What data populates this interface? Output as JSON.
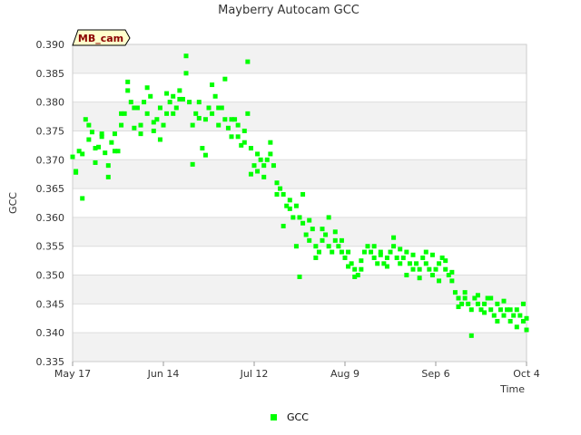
{
  "colors": {
    "series": "#00ff00",
    "band": "#f2f2f2",
    "grid": "#dddddd",
    "badge_bg": "#ffffcc"
  },
  "badge": {
    "label": "MB_cam"
  },
  "chart_data": {
    "type": "scatter",
    "title": "Mayberry Autocam GCC",
    "xlabel": "Time",
    "ylabel": "GCC",
    "x_ticks": [
      "May 17",
      "Jun 14",
      "Jul 12",
      "Aug 9",
      "Sep 6",
      "Oct 4"
    ],
    "x_range": [
      "2020-05-17",
      "2020-10-04"
    ],
    "ylim": [
      0.335,
      0.39
    ],
    "y_ticks": [
      "0.335",
      "0.340",
      "0.345",
      "0.350",
      "0.355",
      "0.360",
      "0.365",
      "0.370",
      "0.375",
      "0.380",
      "0.385",
      "0.390"
    ],
    "grid": "horizontal alternating bands",
    "legend": {
      "position": "bottom-center",
      "entries": [
        "GCC"
      ]
    },
    "series": [
      {
        "name": "GCC",
        "color": "#00ff00",
        "points": [
          [
            "2020-05-17",
            0.3705
          ],
          [
            "2020-05-18",
            0.3678
          ],
          [
            "2020-05-19",
            0.3715
          ],
          [
            "2020-05-20",
            0.3633
          ],
          [
            "2020-05-21",
            0.377
          ],
          [
            "2020-05-22",
            0.3735
          ],
          [
            "2020-05-23",
            0.3748
          ],
          [
            "2020-05-24",
            0.3695
          ],
          [
            "2020-05-25",
            0.3722
          ],
          [
            "2020-05-26",
            0.3745
          ],
          [
            "2020-05-27",
            0.3712
          ],
          [
            "2020-05-28",
            0.369
          ],
          [
            "2020-05-29",
            0.373
          ],
          [
            "2020-05-30",
            0.3745
          ],
          [
            "2020-05-31",
            0.3715
          ],
          [
            "2020-06-01",
            0.376
          ],
          [
            "2020-06-02",
            0.378
          ],
          [
            "2020-06-03",
            0.382
          ],
          [
            "2020-06-04",
            0.38
          ],
          [
            "2020-06-05",
            0.3755
          ],
          [
            "2020-06-06",
            0.379
          ],
          [
            "2020-06-07",
            0.376
          ],
          [
            "2020-06-08",
            0.38
          ],
          [
            "2020-06-09",
            0.378
          ],
          [
            "2020-06-10",
            0.381
          ],
          [
            "2020-06-11",
            0.375
          ],
          [
            "2020-06-12",
            0.377
          ],
          [
            "2020-06-13",
            0.379
          ],
          [
            "2020-06-14",
            0.376
          ],
          [
            "2020-06-15",
            0.378
          ],
          [
            "2020-06-16",
            0.38
          ],
          [
            "2020-06-17",
            0.381
          ],
          [
            "2020-06-18",
            0.379
          ],
          [
            "2020-06-19",
            0.382
          ],
          [
            "2020-06-20",
            0.3805
          ],
          [
            "2020-06-21",
            0.385
          ],
          [
            "2020-06-22",
            0.38
          ],
          [
            "2020-06-23",
            0.376
          ],
          [
            "2020-06-24",
            0.378
          ],
          [
            "2020-06-25",
            0.38
          ],
          [
            "2020-06-26",
            0.372
          ],
          [
            "2020-06-27",
            0.377
          ],
          [
            "2020-06-28",
            0.379
          ],
          [
            "2020-06-29",
            0.378
          ],
          [
            "2020-06-30",
            0.381
          ],
          [
            "2020-07-01",
            0.376
          ],
          [
            "2020-07-02",
            0.379
          ],
          [
            "2020-07-03",
            0.377
          ],
          [
            "2020-07-04",
            0.3755
          ],
          [
            "2020-07-05",
            0.374
          ],
          [
            "2020-07-06",
            0.377
          ],
          [
            "2020-07-07",
            0.374
          ],
          [
            "2020-07-08",
            0.3725
          ],
          [
            "2020-07-09",
            0.375
          ],
          [
            "2020-07-10",
            0.378
          ],
          [
            "2020-07-11",
            0.372
          ],
          [
            "2020-07-12",
            0.369
          ],
          [
            "2020-07-13",
            0.368
          ],
          [
            "2020-07-14",
            0.37
          ],
          [
            "2020-07-15",
            0.369
          ],
          [
            "2020-07-16",
            0.37
          ],
          [
            "2020-07-17",
            0.373
          ],
          [
            "2020-07-18",
            0.369
          ],
          [
            "2020-07-19",
            0.366
          ],
          [
            "2020-07-20",
            0.365
          ],
          [
            "2020-07-21",
            0.364
          ],
          [
            "2020-07-22",
            0.362
          ],
          [
            "2020-07-23",
            0.363
          ],
          [
            "2020-07-24",
            0.36
          ],
          [
            "2020-07-25",
            0.362
          ],
          [
            "2020-07-26",
            0.36
          ],
          [
            "2020-07-27",
            0.359
          ],
          [
            "2020-07-28",
            0.357
          ],
          [
            "2020-07-29",
            0.356
          ],
          [
            "2020-07-30",
            0.358
          ],
          [
            "2020-07-31",
            0.355
          ],
          [
            "2020-08-01",
            0.354
          ],
          [
            "2020-08-02",
            0.356
          ],
          [
            "2020-08-03",
            0.357
          ],
          [
            "2020-08-04",
            0.355
          ],
          [
            "2020-08-05",
            0.354
          ],
          [
            "2020-08-06",
            0.356
          ],
          [
            "2020-08-07",
            0.355
          ],
          [
            "2020-08-08",
            0.354
          ],
          [
            "2020-08-09",
            0.353
          ],
          [
            "2020-08-10",
            0.354
          ],
          [
            "2020-08-11",
            0.352
          ],
          [
            "2020-08-12",
            0.351
          ],
          [
            "2020-08-13",
            0.35
          ],
          [
            "2020-08-14",
            0.351
          ],
          [
            "2020-08-15",
            0.354
          ],
          [
            "2020-08-16",
            0.355
          ],
          [
            "2020-08-17",
            0.354
          ],
          [
            "2020-08-18",
            0.353
          ],
          [
            "2020-08-19",
            0.352
          ],
          [
            "2020-08-20",
            0.354
          ],
          [
            "2020-08-21",
            0.352
          ],
          [
            "2020-08-22",
            0.353
          ],
          [
            "2020-08-23",
            0.354
          ],
          [
            "2020-08-24",
            0.355
          ],
          [
            "2020-08-25",
            0.353
          ],
          [
            "2020-08-26",
            0.352
          ],
          [
            "2020-08-27",
            0.353
          ],
          [
            "2020-08-28",
            0.354
          ],
          [
            "2020-08-29",
            0.352
          ],
          [
            "2020-08-30",
            0.351
          ],
          [
            "2020-08-31",
            0.352
          ],
          [
            "2020-09-01",
            0.351
          ],
          [
            "2020-09-02",
            0.353
          ],
          [
            "2020-09-03",
            0.352
          ],
          [
            "2020-09-04",
            0.351
          ],
          [
            "2020-09-05",
            0.35
          ],
          [
            "2020-09-06",
            0.351
          ],
          [
            "2020-09-07",
            0.352
          ],
          [
            "2020-09-08",
            0.353
          ],
          [
            "2020-09-09",
            0.351
          ],
          [
            "2020-09-10",
            0.35
          ],
          [
            "2020-09-11",
            0.349
          ],
          [
            "2020-09-12",
            0.347
          ],
          [
            "2020-09-13",
            0.346
          ],
          [
            "2020-09-14",
            0.345
          ],
          [
            "2020-09-15",
            0.346
          ],
          [
            "2020-09-16",
            0.345
          ],
          [
            "2020-09-17",
            0.344
          ],
          [
            "2020-09-18",
            0.346
          ],
          [
            "2020-09-19",
            0.345
          ],
          [
            "2020-09-20",
            0.344
          ],
          [
            "2020-09-21",
            0.345
          ],
          [
            "2020-09-22",
            0.346
          ],
          [
            "2020-09-23",
            0.344
          ],
          [
            "2020-09-24",
            0.343
          ],
          [
            "2020-09-25",
            0.345
          ],
          [
            "2020-09-26",
            0.344
          ],
          [
            "2020-09-27",
            0.343
          ],
          [
            "2020-09-28",
            0.344
          ],
          [
            "2020-09-29",
            0.342
          ],
          [
            "2020-09-30",
            0.343
          ],
          [
            "2020-10-01",
            0.344
          ],
          [
            "2020-10-02",
            0.343
          ],
          [
            "2020-10-03",
            0.342
          ],
          [
            "2020-10-04",
            0.3405
          ],
          [
            "2020-05-18",
            0.368
          ],
          [
            "2020-05-20",
            0.371
          ],
          [
            "2020-05-22",
            0.376
          ],
          [
            "2020-05-24",
            0.372
          ],
          [
            "2020-05-26",
            0.374
          ],
          [
            "2020-05-28",
            0.367
          ],
          [
            "2020-05-30",
            0.3715
          ],
          [
            "2020-06-01",
            0.378
          ],
          [
            "2020-06-03",
            0.3835
          ],
          [
            "2020-06-05",
            0.379
          ],
          [
            "2020-06-07",
            0.3745
          ],
          [
            "2020-06-09",
            0.3825
          ],
          [
            "2020-06-11",
            0.3765
          ],
          [
            "2020-06-13",
            0.3735
          ],
          [
            "2020-06-15",
            0.3815
          ],
          [
            "2020-06-17",
            0.378
          ],
          [
            "2020-06-19",
            0.3805
          ],
          [
            "2020-06-21",
            0.388
          ],
          [
            "2020-06-23",
            0.3692
          ],
          [
            "2020-06-25",
            0.3772
          ],
          [
            "2020-06-27",
            0.3708
          ],
          [
            "2020-06-29",
            0.383
          ],
          [
            "2020-07-01",
            0.379
          ],
          [
            "2020-07-03",
            0.384
          ],
          [
            "2020-07-05",
            0.377
          ],
          [
            "2020-07-07",
            0.376
          ],
          [
            "2020-07-09",
            0.373
          ],
          [
            "2020-07-10",
            0.387
          ],
          [
            "2020-07-11",
            0.3675
          ],
          [
            "2020-07-13",
            0.371
          ],
          [
            "2020-07-15",
            0.367
          ],
          [
            "2020-07-17",
            0.371
          ],
          [
            "2020-07-19",
            0.364
          ],
          [
            "2020-07-21",
            0.3585
          ],
          [
            "2020-07-23",
            0.3615
          ],
          [
            "2020-07-25",
            0.355
          ],
          [
            "2020-07-26",
            0.3497
          ],
          [
            "2020-07-27",
            0.364
          ],
          [
            "2020-07-29",
            0.3595
          ],
          [
            "2020-07-31",
            0.353
          ],
          [
            "2020-08-02",
            0.358
          ],
          [
            "2020-08-04",
            0.36
          ],
          [
            "2020-08-06",
            0.3575
          ],
          [
            "2020-08-08",
            0.356
          ],
          [
            "2020-08-10",
            0.3515
          ],
          [
            "2020-08-12",
            0.3497
          ],
          [
            "2020-08-14",
            0.3525
          ],
          [
            "2020-08-18",
            0.355
          ],
          [
            "2020-08-20",
            0.3535
          ],
          [
            "2020-08-22",
            0.3515
          ],
          [
            "2020-08-24",
            0.3565
          ],
          [
            "2020-08-26",
            0.3545
          ],
          [
            "2020-08-28",
            0.35
          ],
          [
            "2020-08-30",
            0.3535
          ],
          [
            "2020-09-01",
            0.3495
          ],
          [
            "2020-09-03",
            0.354
          ],
          [
            "2020-09-05",
            0.3535
          ],
          [
            "2020-09-07",
            0.349
          ],
          [
            "2020-09-09",
            0.3525
          ],
          [
            "2020-09-11",
            0.3505
          ],
          [
            "2020-09-13",
            0.3445
          ],
          [
            "2020-09-15",
            0.347
          ],
          [
            "2020-09-17",
            0.3395
          ],
          [
            "2020-09-19",
            0.3465
          ],
          [
            "2020-09-21",
            0.3435
          ],
          [
            "2020-09-23",
            0.346
          ],
          [
            "2020-09-25",
            0.342
          ],
          [
            "2020-09-27",
            0.3455
          ],
          [
            "2020-09-29",
            0.344
          ],
          [
            "2020-10-01",
            0.341
          ],
          [
            "2020-10-03",
            0.345
          ],
          [
            "2020-10-04",
            0.3425
          ]
        ]
      }
    ]
  }
}
